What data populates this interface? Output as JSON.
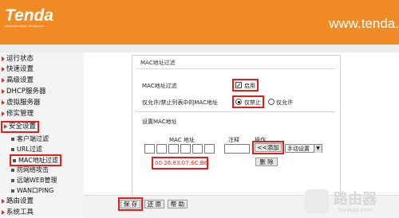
{
  "brand": {
    "logo": "Tenda",
    "tagline": "SHENZHEN TENDA TECHNOLOGY",
    "url": "www.tenda."
  },
  "colors": {
    "header": "#f08a24",
    "highlight": "#e0201b"
  },
  "sidebar": {
    "items": [
      {
        "label": "运行状态"
      },
      {
        "label": "快速设置"
      },
      {
        "label": "高级设置"
      },
      {
        "label": "DHCP服务器"
      },
      {
        "label": "虚拟服务器"
      },
      {
        "label": "修实管理"
      },
      {
        "label": "安全设置"
      },
      {
        "label": "客户端过滤"
      },
      {
        "label": "URL过滤"
      },
      {
        "label": "MAC地址过滤"
      },
      {
        "label": "防网络攻击"
      },
      {
        "label": "远端WEB管理"
      },
      {
        "label": "WAN口PING"
      },
      {
        "label": "路由设置"
      },
      {
        "label": "系统工具"
      }
    ]
  },
  "panel": {
    "title": "MAC地址过滤",
    "mac_filter_label": "MAC地址过滤",
    "enable_label": "启用",
    "enable_checked": "✓",
    "allow_deny_label": "仅允许/禁止列表中的MAC地址",
    "deny_label": "仅禁止",
    "allow_label": "仅允许",
    "set_mac_label": "设置MAC地址",
    "col_mac": "MAC 地址",
    "col_note": "注释",
    "col_action": "操作",
    "add_button": "<<添加",
    "mode_select": "手动设置",
    "delete_button": "删 除",
    "mac_value": "00:26:83:07:6C:B6"
  },
  "buttons": {
    "save": "保 存",
    "restore": "还 原",
    "help": "帮 助"
  },
  "watermark": {
    "title": "路由器",
    "sub": "luyouqi.com"
  }
}
